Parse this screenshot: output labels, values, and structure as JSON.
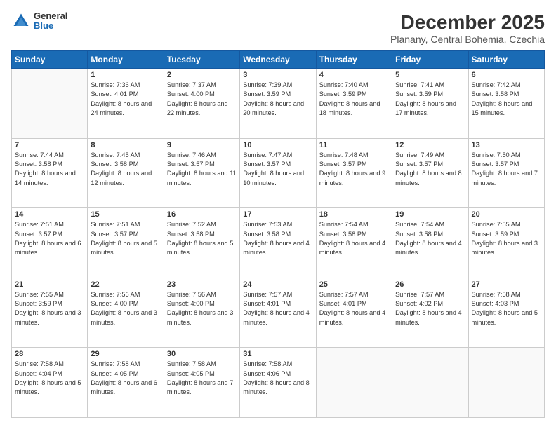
{
  "logo": {
    "general": "General",
    "blue": "Blue"
  },
  "header": {
    "title": "December 2025",
    "location": "Planany, Central Bohemia, Czechia"
  },
  "weekdays": [
    "Sunday",
    "Monday",
    "Tuesday",
    "Wednesday",
    "Thursday",
    "Friday",
    "Saturday"
  ],
  "weeks": [
    [
      {
        "day": "",
        "sunrise": "",
        "sunset": "",
        "daylight": ""
      },
      {
        "day": "1",
        "sunrise": "Sunrise: 7:36 AM",
        "sunset": "Sunset: 4:01 PM",
        "daylight": "Daylight: 8 hours and 24 minutes."
      },
      {
        "day": "2",
        "sunrise": "Sunrise: 7:37 AM",
        "sunset": "Sunset: 4:00 PM",
        "daylight": "Daylight: 8 hours and 22 minutes."
      },
      {
        "day": "3",
        "sunrise": "Sunrise: 7:39 AM",
        "sunset": "Sunset: 3:59 PM",
        "daylight": "Daylight: 8 hours and 20 minutes."
      },
      {
        "day": "4",
        "sunrise": "Sunrise: 7:40 AM",
        "sunset": "Sunset: 3:59 PM",
        "daylight": "Daylight: 8 hours and 18 minutes."
      },
      {
        "day": "5",
        "sunrise": "Sunrise: 7:41 AM",
        "sunset": "Sunset: 3:59 PM",
        "daylight": "Daylight: 8 hours and 17 minutes."
      },
      {
        "day": "6",
        "sunrise": "Sunrise: 7:42 AM",
        "sunset": "Sunset: 3:58 PM",
        "daylight": "Daylight: 8 hours and 15 minutes."
      }
    ],
    [
      {
        "day": "7",
        "sunrise": "Sunrise: 7:44 AM",
        "sunset": "Sunset: 3:58 PM",
        "daylight": "Daylight: 8 hours and 14 minutes."
      },
      {
        "day": "8",
        "sunrise": "Sunrise: 7:45 AM",
        "sunset": "Sunset: 3:58 PM",
        "daylight": "Daylight: 8 hours and 12 minutes."
      },
      {
        "day": "9",
        "sunrise": "Sunrise: 7:46 AM",
        "sunset": "Sunset: 3:57 PM",
        "daylight": "Daylight: 8 hours and 11 minutes."
      },
      {
        "day": "10",
        "sunrise": "Sunrise: 7:47 AM",
        "sunset": "Sunset: 3:57 PM",
        "daylight": "Daylight: 8 hours and 10 minutes."
      },
      {
        "day": "11",
        "sunrise": "Sunrise: 7:48 AM",
        "sunset": "Sunset: 3:57 PM",
        "daylight": "Daylight: 8 hours and 9 minutes."
      },
      {
        "day": "12",
        "sunrise": "Sunrise: 7:49 AM",
        "sunset": "Sunset: 3:57 PM",
        "daylight": "Daylight: 8 hours and 8 minutes."
      },
      {
        "day": "13",
        "sunrise": "Sunrise: 7:50 AM",
        "sunset": "Sunset: 3:57 PM",
        "daylight": "Daylight: 8 hours and 7 minutes."
      }
    ],
    [
      {
        "day": "14",
        "sunrise": "Sunrise: 7:51 AM",
        "sunset": "Sunset: 3:57 PM",
        "daylight": "Daylight: 8 hours and 6 minutes."
      },
      {
        "day": "15",
        "sunrise": "Sunrise: 7:51 AM",
        "sunset": "Sunset: 3:57 PM",
        "daylight": "Daylight: 8 hours and 5 minutes."
      },
      {
        "day": "16",
        "sunrise": "Sunrise: 7:52 AM",
        "sunset": "Sunset: 3:58 PM",
        "daylight": "Daylight: 8 hours and 5 minutes."
      },
      {
        "day": "17",
        "sunrise": "Sunrise: 7:53 AM",
        "sunset": "Sunset: 3:58 PM",
        "daylight": "Daylight: 8 hours and 4 minutes."
      },
      {
        "day": "18",
        "sunrise": "Sunrise: 7:54 AM",
        "sunset": "Sunset: 3:58 PM",
        "daylight": "Daylight: 8 hours and 4 minutes."
      },
      {
        "day": "19",
        "sunrise": "Sunrise: 7:54 AM",
        "sunset": "Sunset: 3:58 PM",
        "daylight": "Daylight: 8 hours and 4 minutes."
      },
      {
        "day": "20",
        "sunrise": "Sunrise: 7:55 AM",
        "sunset": "Sunset: 3:59 PM",
        "daylight": "Daylight: 8 hours and 3 minutes."
      }
    ],
    [
      {
        "day": "21",
        "sunrise": "Sunrise: 7:55 AM",
        "sunset": "Sunset: 3:59 PM",
        "daylight": "Daylight: 8 hours and 3 minutes."
      },
      {
        "day": "22",
        "sunrise": "Sunrise: 7:56 AM",
        "sunset": "Sunset: 4:00 PM",
        "daylight": "Daylight: 8 hours and 3 minutes."
      },
      {
        "day": "23",
        "sunrise": "Sunrise: 7:56 AM",
        "sunset": "Sunset: 4:00 PM",
        "daylight": "Daylight: 8 hours and 3 minutes."
      },
      {
        "day": "24",
        "sunrise": "Sunrise: 7:57 AM",
        "sunset": "Sunset: 4:01 PM",
        "daylight": "Daylight: 8 hours and 4 minutes."
      },
      {
        "day": "25",
        "sunrise": "Sunrise: 7:57 AM",
        "sunset": "Sunset: 4:01 PM",
        "daylight": "Daylight: 8 hours and 4 minutes."
      },
      {
        "day": "26",
        "sunrise": "Sunrise: 7:57 AM",
        "sunset": "Sunset: 4:02 PM",
        "daylight": "Daylight: 8 hours and 4 minutes."
      },
      {
        "day": "27",
        "sunrise": "Sunrise: 7:58 AM",
        "sunset": "Sunset: 4:03 PM",
        "daylight": "Daylight: 8 hours and 5 minutes."
      }
    ],
    [
      {
        "day": "28",
        "sunrise": "Sunrise: 7:58 AM",
        "sunset": "Sunset: 4:04 PM",
        "daylight": "Daylight: 8 hours and 5 minutes."
      },
      {
        "day": "29",
        "sunrise": "Sunrise: 7:58 AM",
        "sunset": "Sunset: 4:05 PM",
        "daylight": "Daylight: 8 hours and 6 minutes."
      },
      {
        "day": "30",
        "sunrise": "Sunrise: 7:58 AM",
        "sunset": "Sunset: 4:05 PM",
        "daylight": "Daylight: 8 hours and 7 minutes."
      },
      {
        "day": "31",
        "sunrise": "Sunrise: 7:58 AM",
        "sunset": "Sunset: 4:06 PM",
        "daylight": "Daylight: 8 hours and 8 minutes."
      },
      {
        "day": "",
        "sunrise": "",
        "sunset": "",
        "daylight": ""
      },
      {
        "day": "",
        "sunrise": "",
        "sunset": "",
        "daylight": ""
      },
      {
        "day": "",
        "sunrise": "",
        "sunset": "",
        "daylight": ""
      }
    ]
  ]
}
